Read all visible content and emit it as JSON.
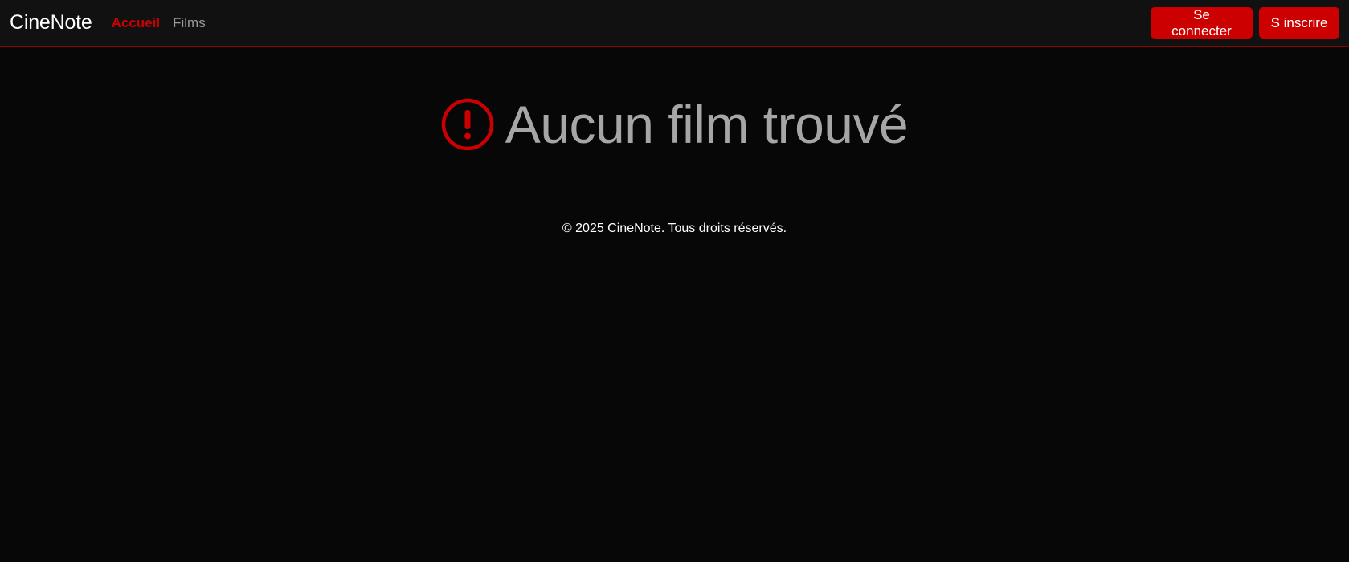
{
  "navbar": {
    "brand": "CineNote",
    "links": [
      {
        "label": "Accueil",
        "active": true
      },
      {
        "label": "Films",
        "active": false
      }
    ],
    "login_label": "Se connecter",
    "register_label": "S inscrire"
  },
  "main": {
    "empty_icon": "exclamation-circle-icon",
    "empty_message": "Aucun film trouvé"
  },
  "footer": {
    "text": "© 2025 CineNote. Tous droits réservés."
  },
  "colors": {
    "accent": "#cc0000",
    "background": "#070707",
    "navbar": "#111111",
    "muted_text": "#a6a6a6"
  }
}
